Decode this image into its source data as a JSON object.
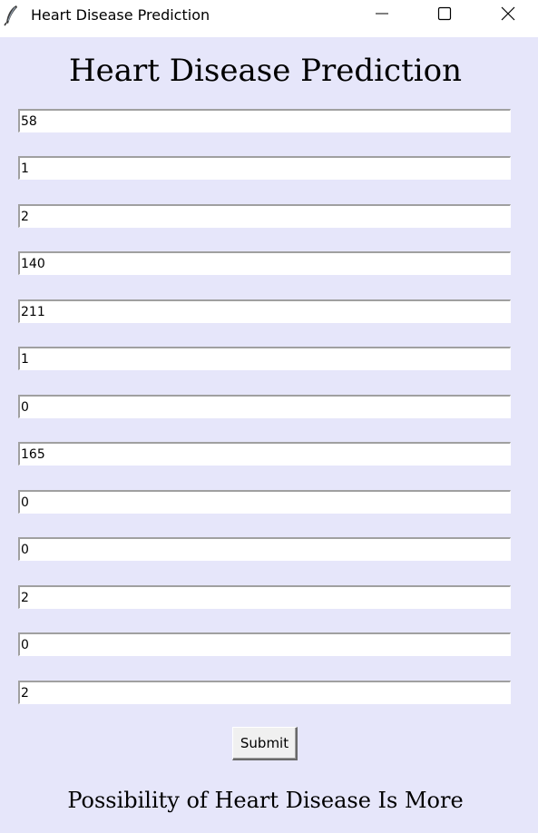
{
  "window": {
    "title": "Heart Disease Prediction",
    "icon": "feather-icon",
    "controls": [
      "minimize-icon",
      "maximize-icon",
      "close-icon"
    ]
  },
  "heading": "Heart Disease Prediction",
  "fields": [
    "58",
    "1",
    "2",
    "140",
    "211",
    "1",
    "0",
    "165",
    "0",
    "0",
    "2",
    "0",
    "2"
  ],
  "submit_label": "Submit",
  "result_text": "Possibility of Heart Disease Is More",
  "colors": {
    "background": "#e6e6fa",
    "titlebar": "#ffffff",
    "field_background": "#ffffff"
  }
}
